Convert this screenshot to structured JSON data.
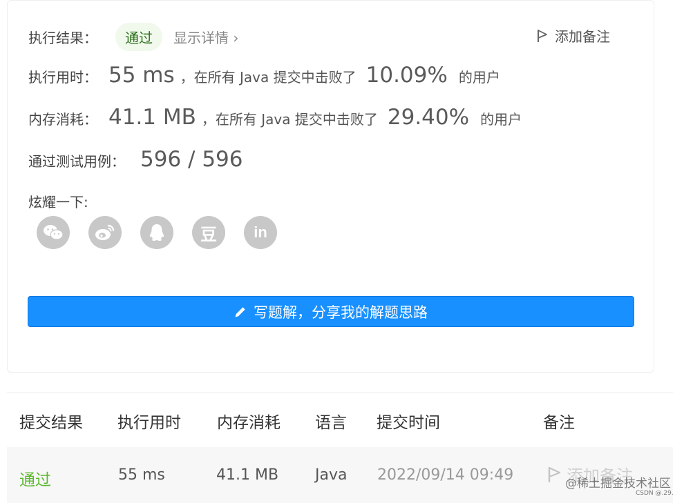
{
  "result": {
    "label": "执行结果：",
    "status": "通过",
    "details_link": "显示详情 ›",
    "add_note": "添加备注"
  },
  "runtime": {
    "label": "执行用时：",
    "value": "55 ms",
    "mid": "，在所有 Java 提交中击败了",
    "percent": "10.09%",
    "tail": "的用户"
  },
  "memory": {
    "label": "内存消耗：",
    "value": "41.1 MB",
    "mid": "，在所有 Java 提交中击败了",
    "percent": "29.40%",
    "tail": "的用户"
  },
  "testcases": {
    "label": "通过测试用例：",
    "value": "596 / 596"
  },
  "share": {
    "label": "炫耀一下:",
    "icons": [
      "wechat-icon",
      "weibo-icon",
      "qq-icon",
      "douban-icon",
      "linkedin-icon"
    ],
    "douban_glyph": "豆",
    "linkedin_glyph": "in"
  },
  "write_solution": {
    "label": "写题解，分享我的解题思路"
  },
  "submissions": {
    "headers": [
      "提交结果",
      "执行用时",
      "内存消耗",
      "语言",
      "提交时间",
      "备注"
    ],
    "rows": [
      {
        "result": "通过",
        "runtime": "55 ms",
        "memory": "41.1 MB",
        "language": "Java",
        "time": "2022/09/14 09:49",
        "note": "添加备注"
      }
    ]
  },
  "watermark": {
    "main": "@稀土掘金技术社区",
    "sub": "CSDN @.29."
  },
  "colors": {
    "accent": "#1890ff",
    "pass": "#5cb82e",
    "icon_gray": "#c8c8c8"
  }
}
